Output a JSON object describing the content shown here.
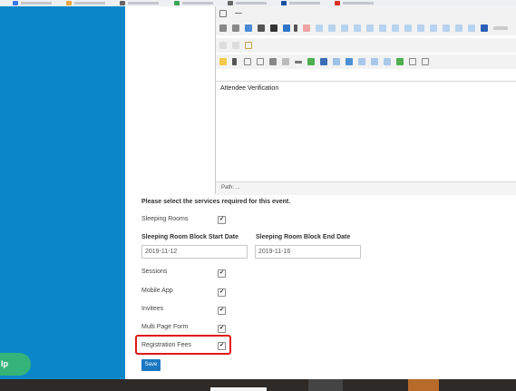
{
  "bookmarks": [
    {
      "icon": "bookmark-icon",
      "color": "#3b78e7"
    },
    {
      "icon": "bookmark-icon",
      "color": "#e8a33b"
    },
    {
      "icon": "bookmark-icon",
      "color": "#666666"
    },
    {
      "icon": "bookmark-icon",
      "color": "#3aa757"
    },
    {
      "icon": "bookmark-icon",
      "color": "#666666"
    },
    {
      "icon": "bookmark-icon",
      "color": "#1a4fa0"
    },
    {
      "icon": "bookmark-icon",
      "color": "#d93025"
    }
  ],
  "sidebar": {
    "help_label": "lp",
    "color": "#0b87c9"
  },
  "editor": {
    "body_text": "Attendee Verification",
    "path_label": "Path: ..."
  },
  "services": {
    "title": "Please select the services required for this event.",
    "items": [
      {
        "label": "Sleeping Rooms",
        "checked": true
      },
      {
        "label": "Sessions",
        "checked": true
      },
      {
        "label": "Mobile App",
        "checked": true
      },
      {
        "label": "Invitees",
        "checked": true
      },
      {
        "label": "Multi Page Form",
        "checked": true
      },
      {
        "label": "Registration Fees",
        "checked": true
      }
    ],
    "check_mark": "✔"
  },
  "dates": {
    "start_label": "Sleeping Room Block Start Date",
    "start_value": "2019-11-12",
    "end_label": "Sleeping Room Block End Date",
    "end_value": "2019-11-16"
  },
  "save_label": "Save",
  "colors": {
    "highlight": "#e01818",
    "save": "#1a78c2",
    "help": "#35b47a"
  }
}
